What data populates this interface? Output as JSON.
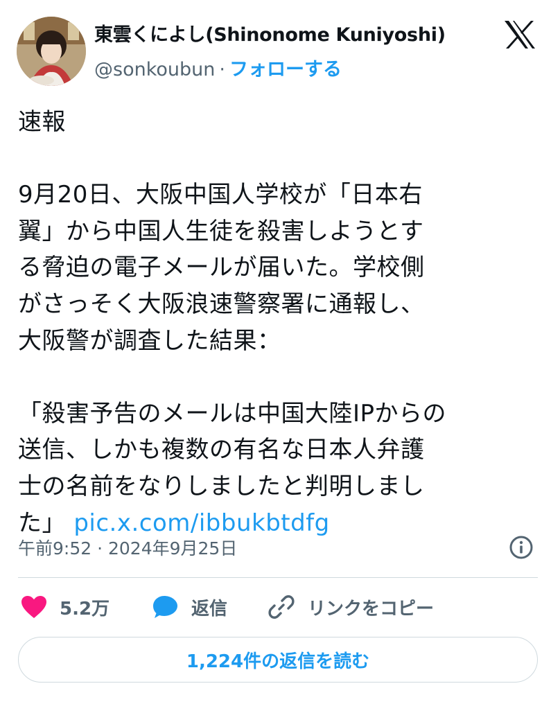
{
  "author": {
    "display_name": "東雲くによし(Shinonome Kuniyoshi)",
    "handle": "@sonkoubun",
    "separator": "·",
    "follow_label": "フォローする"
  },
  "tweet": {
    "text_before_link": "速報\n\n9月20日、大阪中国人学校が「日本右\n翼」から中国人生徒を殺害しようとす\nる脅迫の電子メールが届いた。学校側\nがさっそく大阪浪速警察署に通報し、\n大阪警が調査した結果：\n\n「殺害予告のメールは中国大陸IPからの\n送信、しかも複数の有名な日本人弁護\n士の名前をなりしましたと判明しまし\nた」 ",
    "link_text": "pic.x.com/ibbukbtdfg",
    "timestamp": "午前9:52 · 2024年9月25日"
  },
  "actions": {
    "like_count": "5.2万",
    "reply_label": "返信",
    "copy_link_label": "リンクをコピー"
  },
  "read_replies_label": "1,224件の返信を読む",
  "colors": {
    "accent": "#1d9bf0",
    "like": "#f91880",
    "secondary_text": "#536471",
    "divider": "#cfd9de"
  },
  "icons": [
    "x-logo-icon",
    "info-icon",
    "heart-icon",
    "reply-bubble-icon",
    "link-icon"
  ]
}
